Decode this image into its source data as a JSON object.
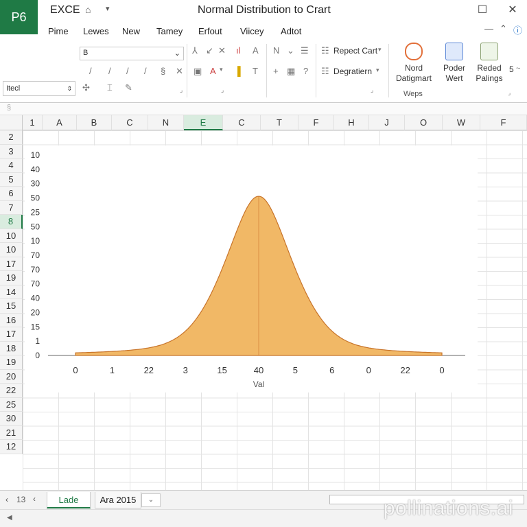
{
  "app": {
    "logo": "P6",
    "name": "EXCE",
    "title": "Normal Distribution to Crart"
  },
  "window_controls": [
    "☐",
    "✕",
    "—"
  ],
  "menu": [
    "Pime",
    "Lewes",
    "New",
    "Tamey",
    "Erfout",
    "Viicey",
    "Adtot"
  ],
  "ribbon": {
    "font_box": "B",
    "name_box": "Itecl",
    "report_chart": "Repect Cart",
    "degration": "Degratiern",
    "nord_label": "Nord\nDatigmart",
    "poder_label": "Poder\nWert",
    "reded_label": "Reded\nPalings",
    "group_label": "Weps",
    "s_label": "5"
  },
  "columns": [
    "1",
    "A",
    "B",
    "C",
    "N",
    "E",
    "C",
    "T",
    "F",
    "H",
    "J",
    "O",
    "W",
    "F"
  ],
  "selected_column": "E",
  "rows": [
    "2",
    "3",
    "4",
    "5",
    "6",
    "7",
    "8",
    "10",
    "10",
    "17",
    "19",
    "14",
    "15",
    "16",
    "17",
    "18",
    "19",
    "20",
    "22",
    "25",
    "30",
    "21",
    "12"
  ],
  "selected_row": "8",
  "chart_data": {
    "type": "area",
    "x_tick_labels": [
      "0",
      "1",
      "22",
      "3",
      "15",
      "40",
      "5",
      "6",
      "0",
      "22",
      "0"
    ],
    "y_tick_labels": [
      "10",
      "40",
      "30",
      "50",
      "25",
      "50",
      "10",
      "70",
      "70",
      "70",
      "40",
      "20",
      "15",
      "1",
      "0"
    ],
    "xlabel": "Val",
    "curve": {
      "mean_x_index": 5,
      "values": [
        0.5,
        2,
        6,
        14,
        32,
        100,
        32,
        14,
        6,
        2,
        0.5
      ]
    },
    "fill_color": "#f0b055",
    "line_color": "#c8742a",
    "grid": true
  },
  "sheet_tabs": {
    "nav": "13",
    "tab1": "Lade",
    "tab2": "Ara 2015"
  },
  "watermark": "pollinations.ai"
}
